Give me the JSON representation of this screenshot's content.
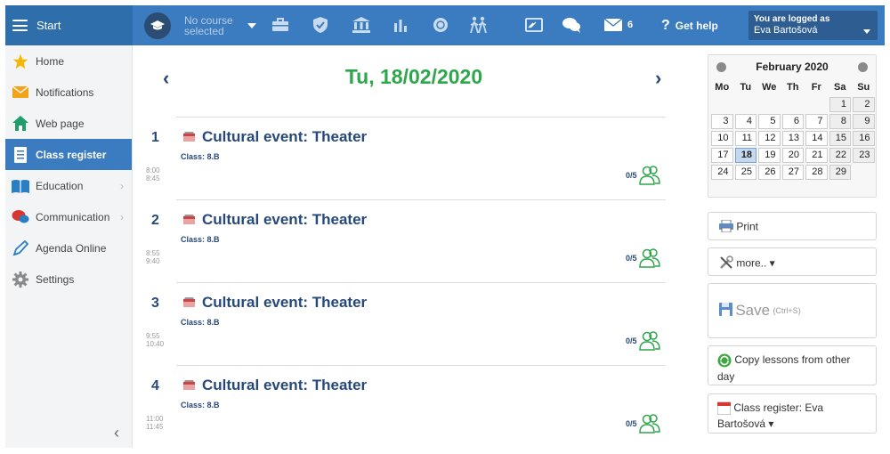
{
  "topbar": {
    "start_label": "Start",
    "course_line1": "No course",
    "course_line2": "selected",
    "message_count": "6",
    "help_label": "Get help",
    "logged_label": "You are logged as",
    "user_name": "Eva Bartošová"
  },
  "sidebar": {
    "items": [
      {
        "label": "Home",
        "icon": "star-icon"
      },
      {
        "label": "Notifications",
        "icon": "envelope-icon"
      },
      {
        "label": "Web page",
        "icon": "house-icon"
      },
      {
        "label": "Class register",
        "icon": "register-icon"
      },
      {
        "label": "Education",
        "icon": "book-icon"
      },
      {
        "label": "Communication",
        "icon": "chat-icon"
      },
      {
        "label": "Agenda Online",
        "icon": "pen-icon"
      },
      {
        "label": "Settings",
        "icon": "gear-icon"
      }
    ],
    "collapse_glyph": "‹"
  },
  "main": {
    "date": "Tu, 18/02/2020",
    "prev": "‹",
    "next": "›",
    "lessons": [
      {
        "num": "1",
        "title": "Cultural event: Theater",
        "class": "Class: 8.B",
        "start": "8:00",
        "end": "8:45",
        "attendance": "0/5"
      },
      {
        "num": "2",
        "title": "Cultural event: Theater",
        "class": "Class: 8.B",
        "start": "8:55",
        "end": "9:40",
        "attendance": "0/5"
      },
      {
        "num": "3",
        "title": "Cultural event: Theater",
        "class": "Class: 8.B",
        "start": "9:55",
        "end": "10:40",
        "attendance": "0/5"
      },
      {
        "num": "4",
        "title": "Cultural event: Theater",
        "class": "Class: 8.B",
        "start": "11:00",
        "end": "11:45",
        "attendance": "0/5"
      }
    ]
  },
  "calendar": {
    "month": "February 2020",
    "day_headers": [
      "Mo",
      "Tu",
      "We",
      "Th",
      "Fr",
      "Sa",
      "Su"
    ],
    "weeks": [
      [
        "",
        "",
        "",
        "",
        "",
        "1",
        "2"
      ],
      [
        "3",
        "4",
        "5",
        "6",
        "7",
        "8",
        "9"
      ],
      [
        "10",
        "11",
        "12",
        "13",
        "14",
        "15",
        "16"
      ],
      [
        "17",
        "18",
        "19",
        "20",
        "21",
        "22",
        "23"
      ],
      [
        "24",
        "25",
        "26",
        "27",
        "28",
        "29",
        ""
      ]
    ],
    "selected": "18"
  },
  "actions": {
    "print": "Print",
    "more": "more.. ▾",
    "save": "Save",
    "save_shortcut": "(Ctrl+S)",
    "copy": "Copy lessons from other day",
    "register_line1": "Class register: Eva",
    "register_line2": "Bartošová ▾"
  },
  "colors": {
    "topbar": "#2e6fab",
    "accent": "#3b7cc0",
    "date_green": "#2ea64b",
    "navy": "#27497a"
  }
}
